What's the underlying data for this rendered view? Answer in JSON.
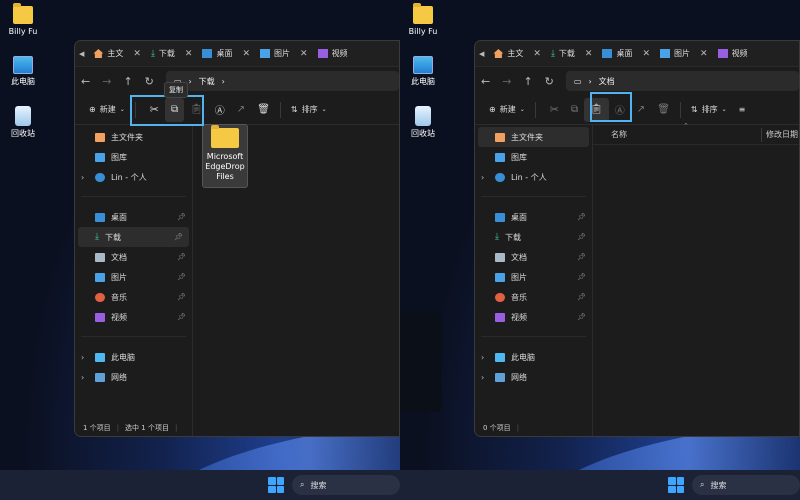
{
  "desktop": {
    "icons": [
      {
        "label": "Billy Fu",
        "icon": "folder-icon"
      },
      {
        "label": "此电脑",
        "icon": "pc-icon"
      },
      {
        "label": "回收站",
        "icon": "recycle-bin-icon"
      }
    ]
  },
  "tabs": [
    {
      "label": "主文",
      "icon": "home-icon"
    },
    {
      "label": "下载",
      "icon": "download-icon"
    },
    {
      "label": "桌面",
      "icon": "desktop-icon"
    },
    {
      "label": "图片",
      "icon": "pictures-icon"
    },
    {
      "label": "视频",
      "icon": "videos-icon"
    }
  ],
  "left": {
    "breadcrumb": "下载",
    "tooltip": "复制",
    "new_label": "新建",
    "sort_label": "排序",
    "status_count": "1 个项目",
    "status_selected": "选中 1 个项目",
    "file_name": "Microsoft EdgeDrop Files"
  },
  "right": {
    "breadcrumb": "文档",
    "new_label": "新建",
    "sort_label": "排序",
    "col_name": "名称",
    "col_modified": "修改日期",
    "status_count": "0 个项目"
  },
  "nav": {
    "home": "主文件夹",
    "gallery": "图库",
    "onedrive": "Lin - 个人",
    "desktop": "桌面",
    "downloads": "下载",
    "documents": "文档",
    "pictures": "图片",
    "music": "音乐",
    "videos": "视频",
    "thispc": "此电脑",
    "network": "网络"
  },
  "taskbar": {
    "search_label": "搜索"
  },
  "colors": {
    "accent": "#53b3ee",
    "folder": "#f6c945"
  }
}
